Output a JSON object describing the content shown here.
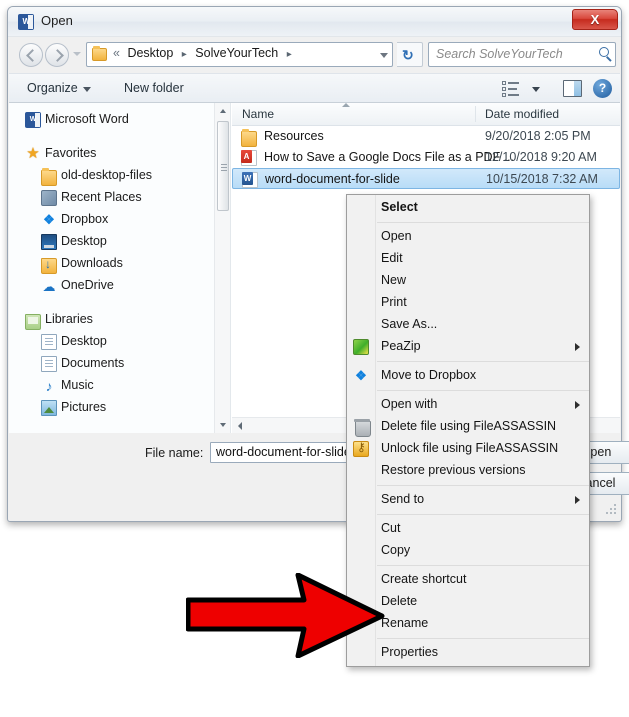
{
  "window": {
    "title": "Open",
    "title_icon": "word-icon",
    "close_label": "X"
  },
  "address": {
    "back_icon": "back-arrow-icon",
    "forward_icon": "forward-arrow-icon",
    "history_icon": "history-dropdown-icon",
    "folder_icon": "folder-icon",
    "chevron": "«",
    "crumbs": [
      "Desktop",
      "SolveYourTech"
    ],
    "separator": "▸",
    "dropdown_icon": "chevron-down-icon",
    "refresh_icon": "refresh-icon",
    "refresh_glyph": "↻"
  },
  "search": {
    "placeholder": "Search SolveYourTech",
    "icon": "search-icon"
  },
  "toolbar": {
    "organize_label": "Organize",
    "new_folder_label": "New folder",
    "view_icon": "view-list-icon",
    "view_caret_icon": "chevron-down-icon",
    "preview_pane_icon": "preview-pane-icon",
    "help_icon": "help-icon",
    "help_glyph": "?"
  },
  "sidebar": {
    "items": [
      {
        "label": "Microsoft Word",
        "icon": "word-icon",
        "level": "head",
        "glyph": "W"
      },
      {
        "label": "Favorites",
        "icon": "star-icon",
        "level": "head",
        "glyph": "★"
      },
      {
        "label": "old-desktop-files",
        "icon": "folder-icon",
        "level": "child"
      },
      {
        "label": "Recent Places",
        "icon": "recent-places-icon",
        "level": "child"
      },
      {
        "label": "Dropbox",
        "icon": "dropbox-icon",
        "level": "child",
        "glyph": "❖"
      },
      {
        "label": "Desktop",
        "icon": "desktop-icon",
        "level": "child"
      },
      {
        "label": "Downloads",
        "icon": "downloads-icon",
        "level": "child"
      },
      {
        "label": "OneDrive",
        "icon": "onedrive-icon",
        "level": "child",
        "glyph": "☁"
      },
      {
        "label": "Libraries",
        "icon": "libraries-icon",
        "level": "head"
      },
      {
        "label": "Desktop",
        "icon": "document-icon",
        "level": "child"
      },
      {
        "label": "Documents",
        "icon": "document-icon",
        "level": "child"
      },
      {
        "label": "Music",
        "icon": "music-icon",
        "level": "child",
        "glyph": "♪"
      },
      {
        "label": "Pictures",
        "icon": "pictures-icon",
        "level": "child"
      }
    ]
  },
  "filelist": {
    "columns": [
      "Name",
      "Date modified"
    ],
    "rows": [
      {
        "name": "Resources",
        "date": "9/20/2018 2:05 PM",
        "icon": "folder-icon",
        "selected": false
      },
      {
        "name": "How to Save a Google Docs File as a PDF ...",
        "date": "12/10/2018 9:20 AM",
        "icon": "pdf-icon",
        "selected": false
      },
      {
        "name": "word-document-for-slide",
        "date": "10/15/2018 7:32 AM",
        "icon": "word-icon",
        "selected": true
      }
    ]
  },
  "footer": {
    "file_name_label": "File name:",
    "file_name_value": "word-document-for-slide",
    "open_label": "Open",
    "cancel_label": "Cancel",
    "resize_grip_icon": "resize-grip-icon"
  },
  "context_menu": {
    "items": [
      {
        "label": "Select",
        "bold": true,
        "submenu": false,
        "icon": null,
        "sep_after": true
      },
      {
        "label": "Open",
        "bold": false,
        "submenu": false,
        "icon": null
      },
      {
        "label": "Edit",
        "bold": false,
        "submenu": false,
        "icon": null
      },
      {
        "label": "New",
        "bold": false,
        "submenu": false,
        "icon": null
      },
      {
        "label": "Print",
        "bold": false,
        "submenu": false,
        "icon": null
      },
      {
        "label": "Save As...",
        "bold": false,
        "submenu": false,
        "icon": null
      },
      {
        "label": "PeaZip",
        "bold": false,
        "submenu": true,
        "icon": "peazip-icon",
        "sep_after": true
      },
      {
        "label": "Move to Dropbox",
        "bold": false,
        "submenu": false,
        "icon": "dropbox-icon",
        "glyph": "❖",
        "sep_after": true
      },
      {
        "label": "Open with",
        "bold": false,
        "submenu": true,
        "icon": null
      },
      {
        "label": "Delete file using FileASSASSIN",
        "bold": false,
        "submenu": false,
        "icon": "trash-icon"
      },
      {
        "label": "Unlock file using FileASSASSIN",
        "bold": false,
        "submenu": false,
        "icon": "key-icon"
      },
      {
        "label": "Restore previous versions",
        "bold": false,
        "submenu": false,
        "icon": null,
        "sep_after": true
      },
      {
        "label": "Send to",
        "bold": false,
        "submenu": true,
        "icon": null,
        "sep_after": true
      },
      {
        "label": "Cut",
        "bold": false,
        "submenu": false,
        "icon": null
      },
      {
        "label": "Copy",
        "bold": false,
        "submenu": false,
        "icon": null,
        "sep_after": true
      },
      {
        "label": "Create shortcut",
        "bold": false,
        "submenu": false,
        "icon": null
      },
      {
        "label": "Delete",
        "bold": false,
        "submenu": false,
        "icon": null
      },
      {
        "label": "Rename",
        "bold": false,
        "submenu": false,
        "icon": null,
        "sep_after": true
      },
      {
        "label": "Properties",
        "bold": false,
        "submenu": false,
        "icon": null
      }
    ]
  },
  "annotation": {
    "icon": "red-arrow-icon",
    "fill": "#ee0000",
    "stroke": "#000000"
  }
}
